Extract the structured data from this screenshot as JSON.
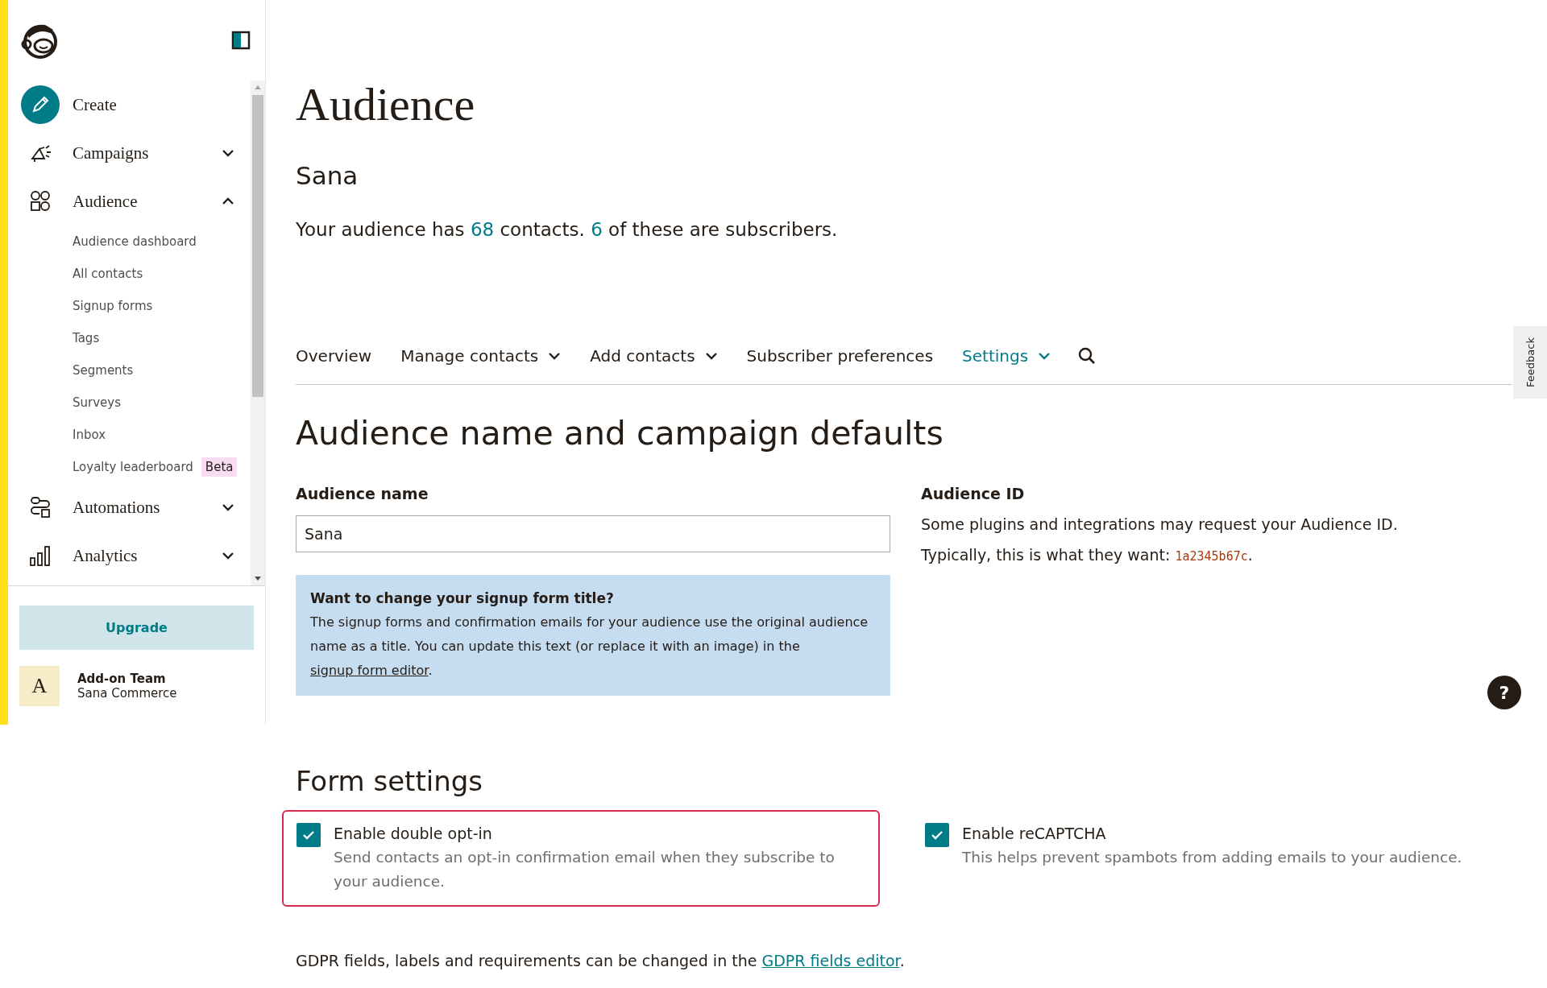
{
  "sidebar": {
    "nav": [
      {
        "kind": "create",
        "label": "Create"
      },
      {
        "kind": "menu",
        "label": "Campaigns",
        "expanded": false
      },
      {
        "kind": "menu",
        "label": "Audience",
        "expanded": true,
        "children": [
          {
            "label": "Audience dashboard"
          },
          {
            "label": "All contacts"
          },
          {
            "label": "Signup forms"
          },
          {
            "label": "Tags"
          },
          {
            "label": "Segments"
          },
          {
            "label": "Surveys"
          },
          {
            "label": "Inbox"
          },
          {
            "label": "Loyalty leaderboard",
            "badge": "Beta"
          }
        ]
      },
      {
        "kind": "menu",
        "label": "Automations",
        "expanded": false
      },
      {
        "kind": "menu",
        "label": "Analytics",
        "expanded": false
      }
    ],
    "upgrade_button": "Upgrade",
    "account": {
      "avatar_letter": "A",
      "name": "Add-on Team",
      "company": "Sana Commerce"
    }
  },
  "page": {
    "title": "Audience",
    "audience": "Sana",
    "summary": {
      "before": "Your audience has ",
      "contacts": "68",
      "middle": " contacts. ",
      "subscribers": "6",
      "after": " of these are subscribers."
    },
    "tabs": [
      {
        "label": "Overview",
        "selected": false,
        "dropdown": false
      },
      {
        "label": "Manage contacts",
        "selected": false,
        "dropdown": true
      },
      {
        "label": "Add contacts",
        "selected": false,
        "dropdown": true
      },
      {
        "label": "Subscriber preferences",
        "selected": false,
        "dropdown": false
      },
      {
        "label": "Settings",
        "selected": true,
        "dropdown": true
      }
    ],
    "section_title": "Audience name and campaign defaults",
    "audience_name": {
      "label": "Audience name",
      "value": "Sana"
    },
    "info_box": {
      "title": "Want to change your signup form title?",
      "text": "The signup forms and confirmation emails for your audience use the original audience name as a title. You can update this text (or replace it with an image) in the ",
      "link": "signup form editor",
      "after": "."
    },
    "audience_id": {
      "label": "Audience ID",
      "text": "Some plugins and integrations may request your Audience ID.",
      "prefix": "Typically, this is what they want: ",
      "id": "1a2345b67c",
      "suffix": "."
    },
    "form_settings": {
      "title": "Form settings",
      "options": [
        {
          "label": "Enable double opt-in",
          "description": "Send contacts an opt-in confirmation email when they subscribe to your audience.",
          "checked": true,
          "highlighted": true
        },
        {
          "label": "Enable reCAPTCHA",
          "description": "This helps prevent spambots from adding emails to your audience.",
          "checked": true,
          "highlighted": false
        }
      ]
    },
    "gdpr": {
      "text": "GDPR fields, labels and requirements can be changed in the ",
      "link": "GDPR fields editor",
      "after": "."
    }
  },
  "feedback_tab": "Feedback",
  "help_button": "?"
}
